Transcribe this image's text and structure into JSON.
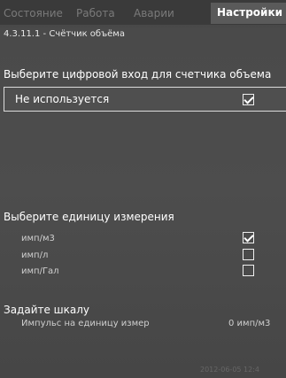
{
  "tabs": [
    {
      "label": "Состояние"
    },
    {
      "label": "Работа"
    },
    {
      "label": "Аварии"
    },
    {
      "label": "Настройки"
    }
  ],
  "breadcrumb": "4.3.11.1 - Счётчик объёма",
  "sections": {
    "digital_input_title": "Выберите цифровой вход для счетчика объема",
    "selected_input": "Не используется",
    "unit_title": "Выберите единицу измерения",
    "unit_options": [
      {
        "label": "имп/м3",
        "checked": true
      },
      {
        "label": "имп/л",
        "checked": false
      },
      {
        "label": "имп/Гал",
        "checked": false
      }
    ],
    "scale_title": "Задайте шкалу",
    "scale_label": "Импульс на единицу измер",
    "scale_value": "0 имп/м3"
  },
  "footer": {
    "timestamp": "2012-06-05 12:4"
  }
}
